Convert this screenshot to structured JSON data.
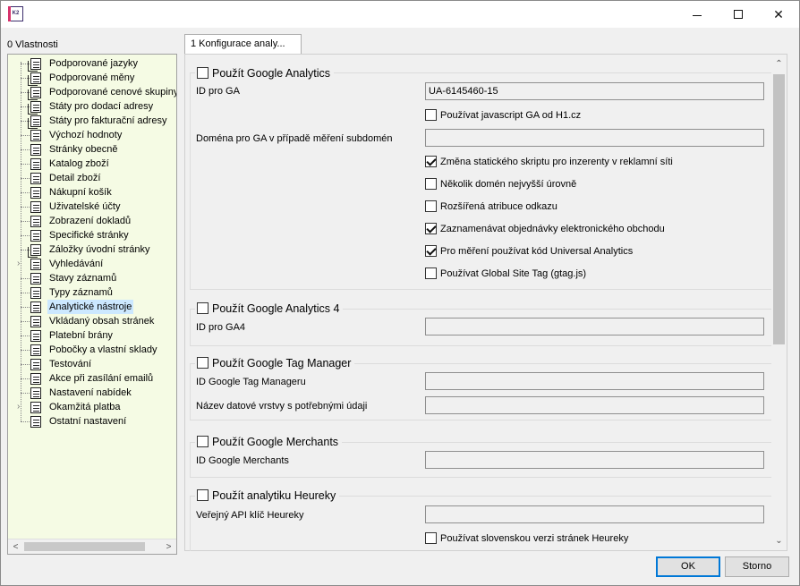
{
  "window": {
    "app_icon_text": "K2"
  },
  "left_panel": {
    "label": "0 Vlastnosti",
    "items": [
      {
        "label": "Podporované jazyky",
        "icon": "document-stack-icon",
        "expandable": false
      },
      {
        "label": "Podporované měny",
        "icon": "document-stack-icon",
        "expandable": false
      },
      {
        "label": "Podporované cenové skupiny",
        "icon": "document-stack-icon",
        "expandable": false
      },
      {
        "label": "Státy pro dodací adresy",
        "icon": "document-stack-icon",
        "expandable": false
      },
      {
        "label": "Státy pro fakturační adresy",
        "icon": "document-stack-icon",
        "expandable": false
      },
      {
        "label": "Výchozí hodnoty",
        "icon": "document-icon",
        "expandable": false
      },
      {
        "label": "Stránky obecně",
        "icon": "document-icon",
        "expandable": false
      },
      {
        "label": "Katalog zboží",
        "icon": "document-icon",
        "expandable": false
      },
      {
        "label": "Detail zboží",
        "icon": "document-icon",
        "expandable": false
      },
      {
        "label": "Nákupní košík",
        "icon": "document-icon",
        "expandable": false
      },
      {
        "label": "Uživatelské účty",
        "icon": "document-icon",
        "expandable": false
      },
      {
        "label": "Zobrazení dokladů",
        "icon": "document-icon",
        "expandable": false
      },
      {
        "label": "Specifické stránky",
        "icon": "document-icon",
        "expandable": false
      },
      {
        "label": "Záložky úvodní stránky",
        "icon": "document-stack-icon",
        "expandable": false
      },
      {
        "label": "Vyhledávání",
        "icon": "document-icon",
        "expandable": true
      },
      {
        "label": "Stavy záznamů",
        "icon": "document-icon",
        "expandable": false
      },
      {
        "label": "Typy záznamů",
        "icon": "document-icon",
        "expandable": false
      },
      {
        "label": "Analytické nástroje",
        "icon": "document-icon",
        "expandable": false,
        "selected": true
      },
      {
        "label": "Vkládaný obsah stránek",
        "icon": "document-icon",
        "expandable": false
      },
      {
        "label": "Platební brány",
        "icon": "document-icon",
        "expandable": false
      },
      {
        "label": "Pobočky a vlastní sklady",
        "icon": "document-icon",
        "expandable": false
      },
      {
        "label": "Testování",
        "icon": "document-icon",
        "expandable": false
      },
      {
        "label": "Akce při zasílání emailů",
        "icon": "document-icon",
        "expandable": false
      },
      {
        "label": "Nastavení nabídek",
        "icon": "document-icon",
        "expandable": false
      },
      {
        "label": "Okamžitá platba",
        "icon": "document-icon",
        "expandable": true
      },
      {
        "label": "Ostatní nastavení",
        "icon": "document-icon",
        "expandable": false
      }
    ]
  },
  "tab": {
    "label": "1 Konfigurace analy..."
  },
  "ga": {
    "title": "Použít Google Analytics",
    "id_label": "ID pro GA",
    "id_value": "UA-6145460-15",
    "js_h1": "Používat javascript GA od H1.cz",
    "domain_label": "Doména pro GA v případě měření subdomén",
    "domain_value": "",
    "static_script": "Změna statického skriptu pro inzerenty v reklamní síti",
    "multi_domain": "Několik domén nejvyšší úrovně",
    "link_attr": "Rozšířená atribuce odkazu",
    "ecommerce": "Zaznamenávat objednávky elektronického obchodu",
    "universal": "Pro měření používat kód Universal Analytics",
    "gtag": "Používat Global Site Tag (gtag.js)"
  },
  "ga4": {
    "title": "Použít Google Analytics 4",
    "id_label": "ID pro GA4",
    "id_value": ""
  },
  "gtm": {
    "title": "Použít Google Tag Manager",
    "id_label": "ID Google Tag Manageru",
    "id_value": "",
    "layer_label": "Název datové vrstvy s potřebnými údaji",
    "layer_value": ""
  },
  "merchants": {
    "title": "Použít Google Merchants",
    "id_label": "ID Google Merchants",
    "id_value": ""
  },
  "heureka": {
    "title": "Použít analytiku Heureky",
    "api_label": "Veřejný API klíč Heureky",
    "api_value": "",
    "sk": "Používat slovenskou verzi stránek Heureky"
  },
  "buttons": {
    "ok": "OK",
    "cancel": "Storno"
  }
}
